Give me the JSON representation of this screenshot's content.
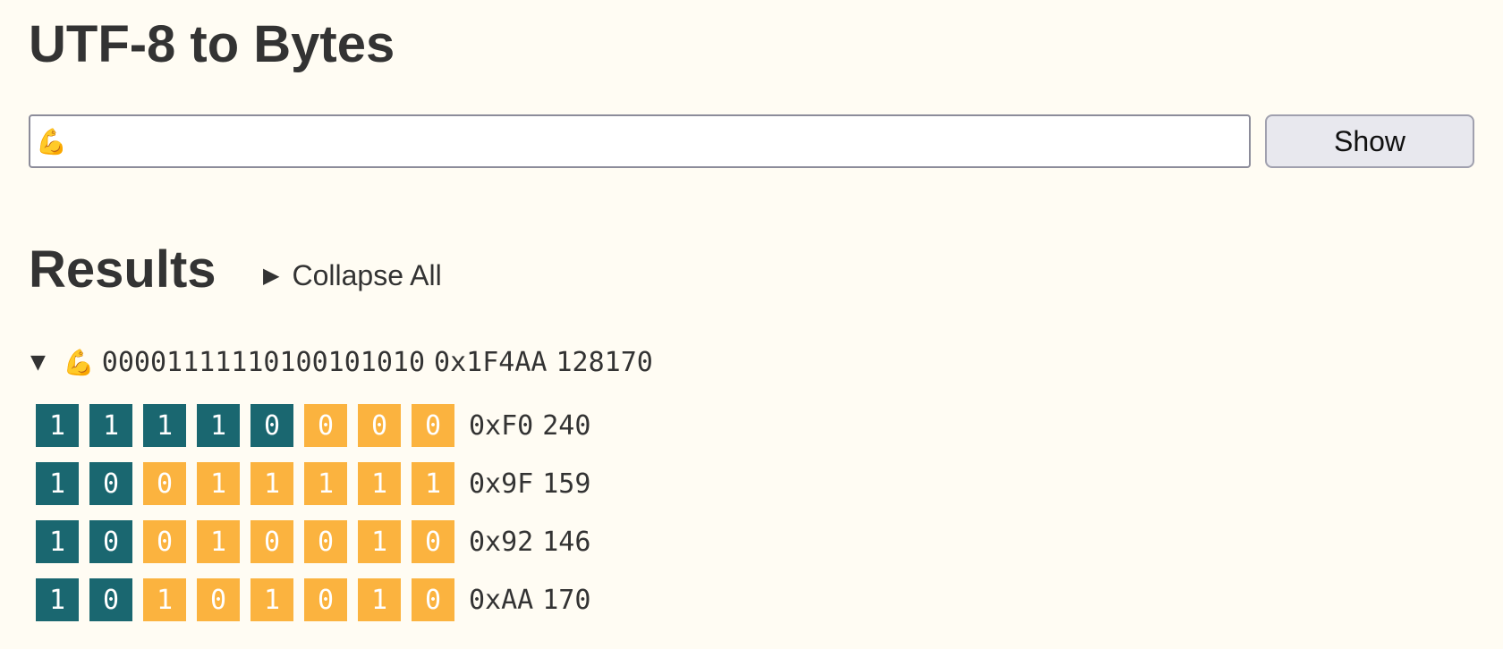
{
  "page": {
    "title": "UTF-8 to Bytes"
  },
  "input": {
    "value": "💪",
    "placeholder": ""
  },
  "show_button": {
    "label": "Show"
  },
  "results": {
    "heading": "Results",
    "collapse_all_icon": "▶",
    "collapse_all_label": "Collapse All",
    "character": {
      "disclosure_icon": "▼",
      "glyph": "💪",
      "binary": "00001111110100101010",
      "hex": "0x1F4AA",
      "decimal": "128170"
    },
    "bytes": [
      {
        "bits": [
          "1",
          "1",
          "1",
          "1",
          "0",
          "0",
          "0",
          "0"
        ],
        "prefix_length": 5,
        "hex": "0xF0",
        "decimal": "240"
      },
      {
        "bits": [
          "1",
          "0",
          "0",
          "1",
          "1",
          "1",
          "1",
          "1"
        ],
        "prefix_length": 2,
        "hex": "0x9F",
        "decimal": "159"
      },
      {
        "bits": [
          "1",
          "0",
          "0",
          "1",
          "0",
          "0",
          "1",
          "0"
        ],
        "prefix_length": 2,
        "hex": "0x92",
        "decimal": "146"
      },
      {
        "bits": [
          "1",
          "0",
          "1",
          "0",
          "1",
          "0",
          "1",
          "0"
        ],
        "prefix_length": 2,
        "hex": "0xAA",
        "decimal": "170"
      }
    ]
  },
  "colors": {
    "background": "#fffcf3",
    "prefix_bit": "#1a6770",
    "payload_bit": "#fbb33f",
    "text": "#333333"
  }
}
